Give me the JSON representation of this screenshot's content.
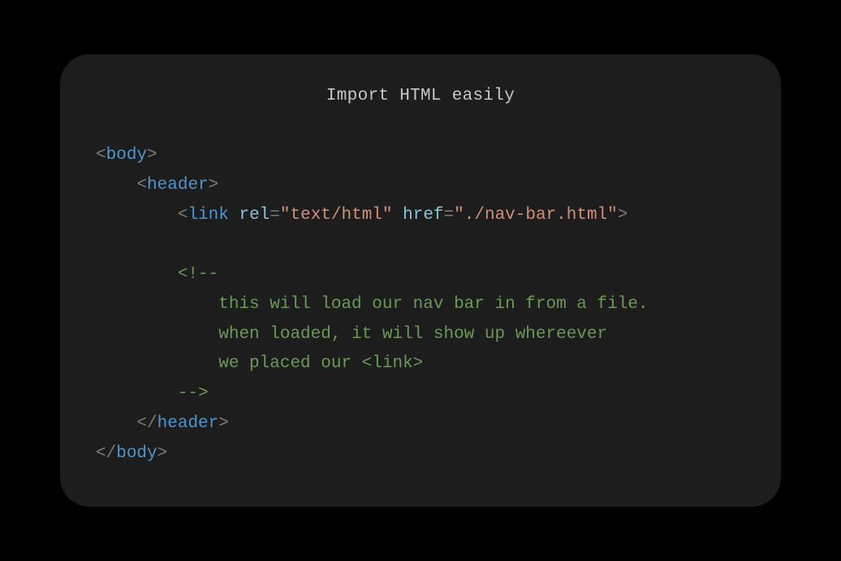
{
  "title": "Import HTML easily",
  "code": {
    "line1": {
      "lt": "<",
      "tag": "body",
      "gt": ">"
    },
    "line2": {
      "indent": "    ",
      "lt": "<",
      "tag": "header",
      "gt": ">"
    },
    "line3": {
      "indent": "        ",
      "lt": "<",
      "tag": "link",
      "space1": " ",
      "attr1": "rel",
      "eq1": "=",
      "val1": "\"text/html\"",
      "space2": " ",
      "attr2": "href",
      "eq2": "=",
      "val2": "\"./nav-bar.html\"",
      "gt": ">"
    },
    "line4": "",
    "line5": {
      "indent": "        ",
      "comment_open": "<!--"
    },
    "line6": {
      "indent": "            ",
      "text": "this will load our nav bar in from a file."
    },
    "line7": {
      "indent": "            ",
      "text": "when loaded, it will show up whereever"
    },
    "line8": {
      "indent": "            ",
      "text": "we placed our <link>"
    },
    "line9": {
      "indent": "        ",
      "comment_close": "-->"
    },
    "line10": {
      "indent": "    ",
      "lt": "</",
      "tag": "header",
      "gt": ">"
    },
    "line11": {
      "lt": "</",
      "tag": "body",
      "gt": ">"
    }
  }
}
